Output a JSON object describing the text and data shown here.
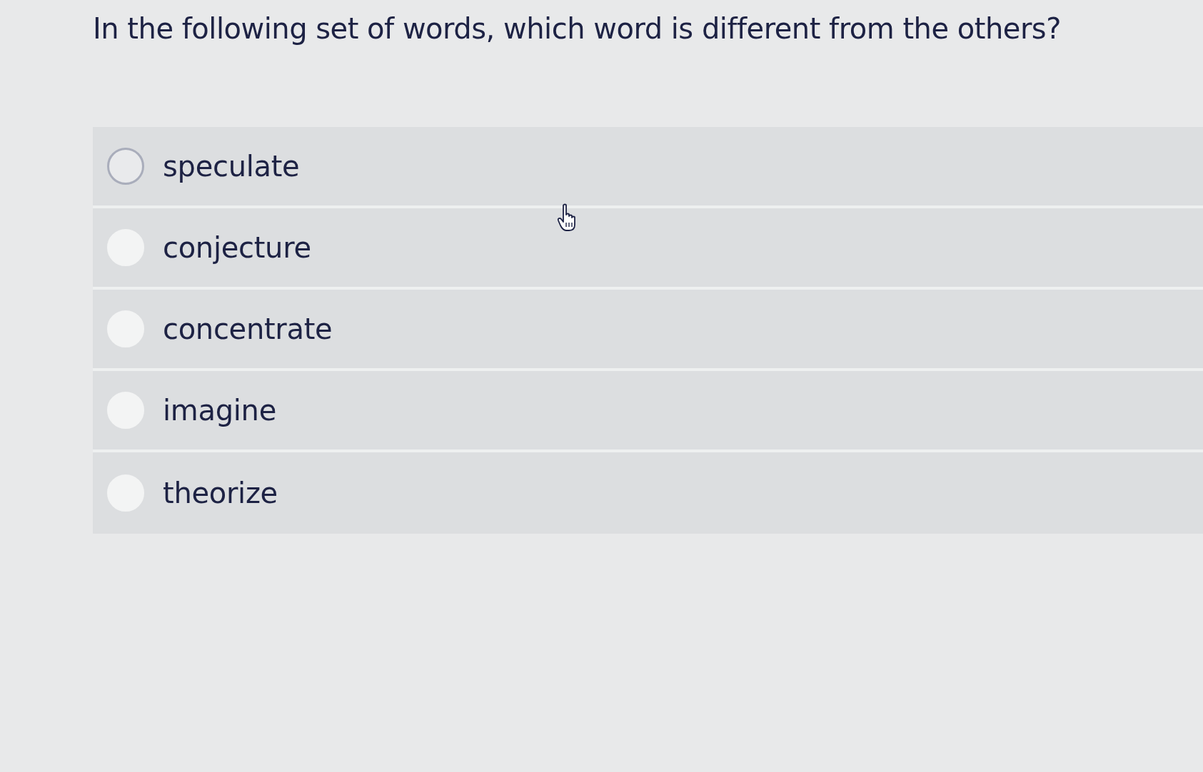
{
  "question": {
    "text": "In the following set of words, which word is different from the others?"
  },
  "options": [
    {
      "label": "speculate",
      "selected": false,
      "focused": true
    },
    {
      "label": "conjecture",
      "selected": false,
      "focused": false
    },
    {
      "label": "concentrate",
      "selected": false,
      "focused": false
    },
    {
      "label": "imagine",
      "selected": false,
      "focused": false
    },
    {
      "label": "theorize",
      "selected": false,
      "focused": false
    }
  ]
}
